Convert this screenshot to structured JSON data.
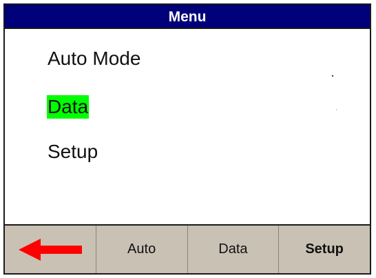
{
  "title": "Menu",
  "menu": {
    "items": [
      {
        "label": "Auto Mode",
        "selected": false
      },
      {
        "label": "Data",
        "selected": true
      },
      {
        "label": "Setup",
        "selected": false
      }
    ]
  },
  "softkeys": {
    "back_icon": "left-arrow-icon",
    "auto_label": "Auto",
    "data_label": "Data",
    "setup_label": "Setup"
  },
  "colors": {
    "title_bar": "#00007a",
    "selection_highlight": "#00ff00",
    "softkey_bar": "#c9c1b4",
    "back_arrow": "#ff0000"
  }
}
